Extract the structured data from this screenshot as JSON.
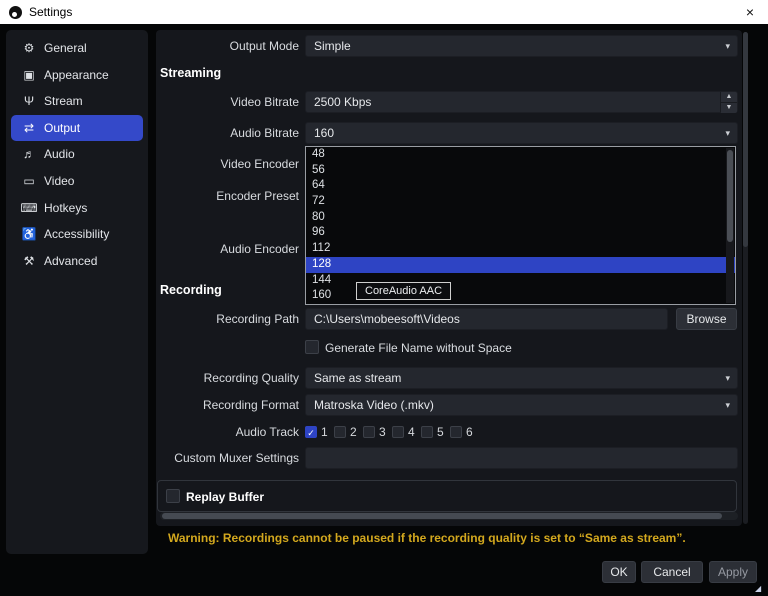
{
  "titlebar": {
    "title": "Settings",
    "close_glyph": "×"
  },
  "sidebar": {
    "selected_item": "Output",
    "items": [
      {
        "name": "general",
        "label": "General",
        "icon": "gear-icon",
        "glyph": "⚙"
      },
      {
        "name": "appearance",
        "label": "Appearance",
        "icon": "appearance-icon",
        "glyph": "▣"
      },
      {
        "name": "stream",
        "label": "Stream",
        "icon": "antenna-icon",
        "glyph": "Ψ"
      },
      {
        "name": "output",
        "label": "Output",
        "icon": "output-icon",
        "glyph": "⇄"
      },
      {
        "name": "audio",
        "label": "Audio",
        "icon": "speaker-icon",
        "glyph": "♬"
      },
      {
        "name": "video",
        "label": "Video",
        "icon": "display-icon",
        "glyph": "▭"
      },
      {
        "name": "hotkeys",
        "label": "Hotkeys",
        "icon": "keyboard-icon",
        "glyph": "⌨"
      },
      {
        "name": "accessibility",
        "label": "Accessibility",
        "icon": "accessibility-icon",
        "glyph": "♿"
      },
      {
        "name": "advanced",
        "label": "Advanced",
        "icon": "tools-icon",
        "glyph": "⚒"
      }
    ]
  },
  "output_mode": {
    "label": "Output Mode",
    "value": "Simple"
  },
  "streaming": {
    "header": "Streaming",
    "video_bitrate_label": "Video Bitrate",
    "video_bitrate_value": "2500 Kbps",
    "audio_bitrate_label": "Audio Bitrate",
    "audio_bitrate_value": "160",
    "video_encoder_label": "Video Encoder",
    "encoder_preset_label": "Encoder Preset",
    "audio_encoder_label": "Audio Encoder"
  },
  "audio_bitrate_dropdown": {
    "options": [
      "48",
      "56",
      "64",
      "72",
      "80",
      "96",
      "112",
      "128",
      "144",
      "160"
    ],
    "highlighted": "128"
  },
  "tooltip": {
    "text": "CoreAudio AAC"
  },
  "recording": {
    "header": "Recording",
    "path_label": "Recording Path",
    "path_value": "C:\\Users\\mobeesoft\\Videos",
    "browse_label": "Browse",
    "filename_checkbox_label": "Generate File Name without Space",
    "filename_checkbox_checked": false,
    "quality_label": "Recording Quality",
    "quality_value": "Same as stream",
    "format_label": "Recording Format",
    "format_value": "Matroska Video (.mkv)",
    "audio_track_label": "Audio Track",
    "tracks": [
      {
        "label": "1",
        "checked": true,
        "check_glyph": "✓"
      },
      {
        "label": "2",
        "checked": false,
        "check_glyph": ""
      },
      {
        "label": "3",
        "checked": false,
        "check_glyph": ""
      },
      {
        "label": "4",
        "checked": false,
        "check_glyph": ""
      },
      {
        "label": "5",
        "checked": false,
        "check_glyph": ""
      },
      {
        "label": "6",
        "checked": false,
        "check_glyph": ""
      }
    ],
    "muxer_label": "Custom Muxer Settings",
    "muxer_value": ""
  },
  "replay_buffer": {
    "label": "Replay Buffer",
    "checked": false
  },
  "warning_text": "Warning: Recordings cannot be paused if the recording quality is set to “Same as stream”.",
  "footer_buttons": {
    "ok": "OK",
    "cancel": "Cancel",
    "apply": "Apply"
  },
  "colors": {
    "accent_blue": "#3449c9",
    "selection_blue": "#2e44c4",
    "warning_yellow": "#d3a81e",
    "titlebar_bg": "#ffffff",
    "panel_bg": "#16181d",
    "field_bg": "#24272e"
  }
}
